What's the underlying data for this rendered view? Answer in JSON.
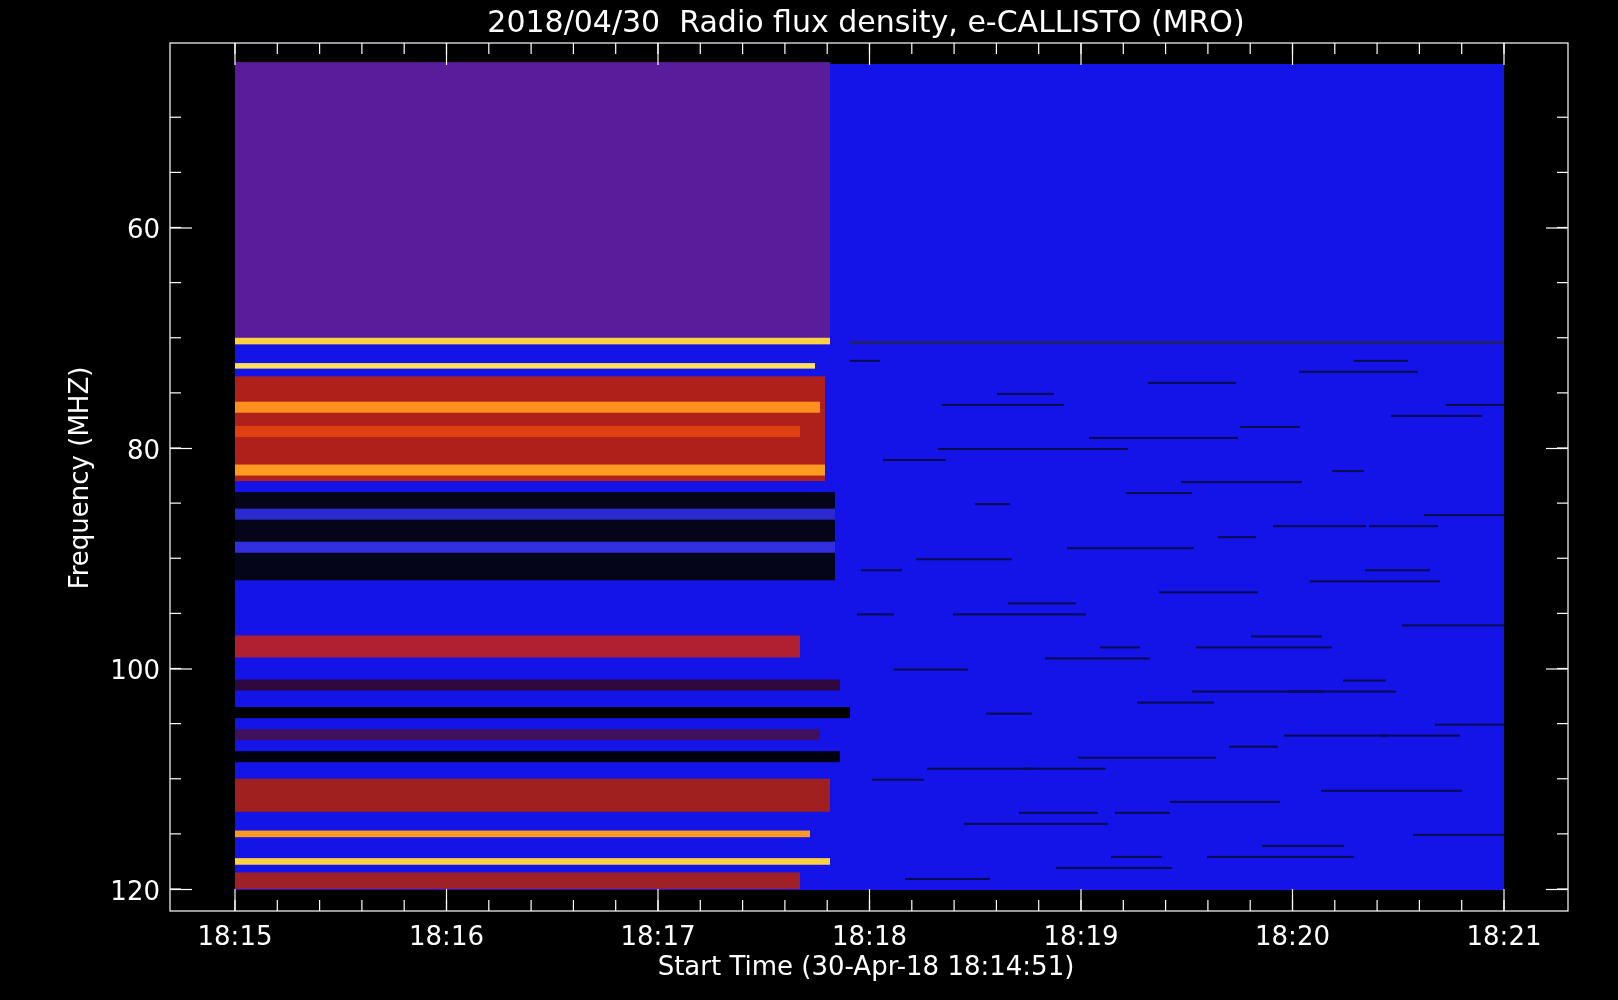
{
  "title": "2018/04/30  Radio flux density, e-CALLISTO (MRO)",
  "plot": {
    "ylabel": "Frequency (MHZ)",
    "xlabel": "Start Time (30-Apr-18 18:14:51)",
    "yticks": [
      "60",
      "80",
      "100",
      "120"
    ],
    "xticks": [
      "18:15",
      "18:16",
      "18:17",
      "18:18",
      "18:19",
      "18:20",
      "18:21"
    ]
  }
}
